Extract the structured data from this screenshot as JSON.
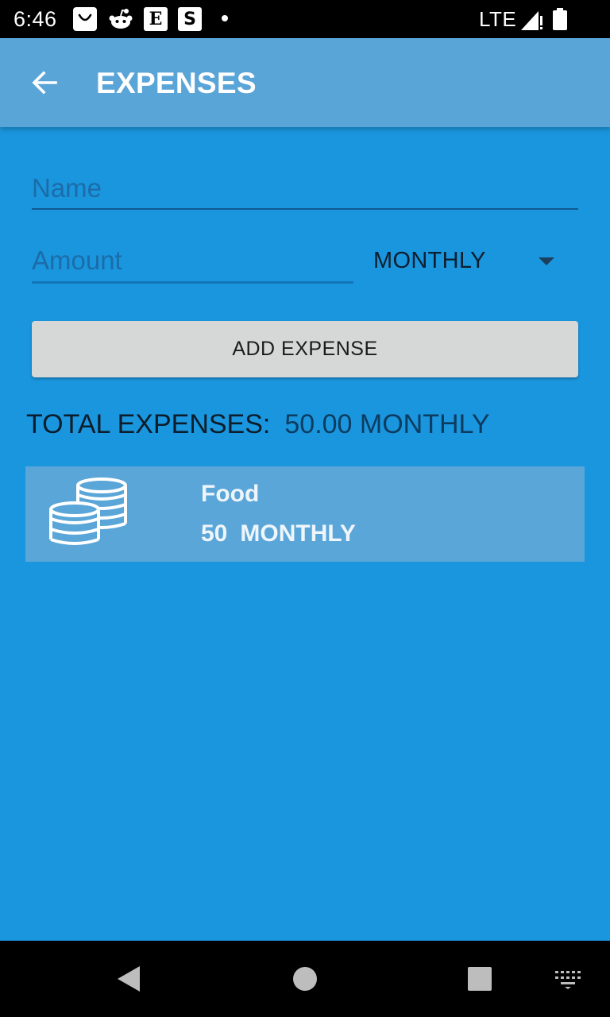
{
  "status_bar": {
    "time": "6:46",
    "network": "LTE",
    "notification_icons": [
      "shopping-bag-icon",
      "reddit-icon",
      "etsy-icon",
      "s-app-icon"
    ],
    "etsy_letter": "E",
    "s_letter": "S"
  },
  "app_bar": {
    "title": "EXPENSES"
  },
  "form": {
    "name_placeholder": "Name",
    "name_value": "",
    "amount_placeholder": "Amount",
    "amount_value": "",
    "period_selected": "MONTHLY",
    "add_button_label": "ADD EXPENSE"
  },
  "summary": {
    "label": "TOTAL EXPENSES:",
    "value": "50.00 MONTHLY"
  },
  "expenses": [
    {
      "name": "Food",
      "amount": "50",
      "period": "MONTHLY",
      "icon": "coins-icon"
    }
  ],
  "colors": {
    "background": "#1a96de",
    "app_bar": "#5aa5d8",
    "list_item": "#5ba6d8",
    "button": "#d6d7d7"
  }
}
